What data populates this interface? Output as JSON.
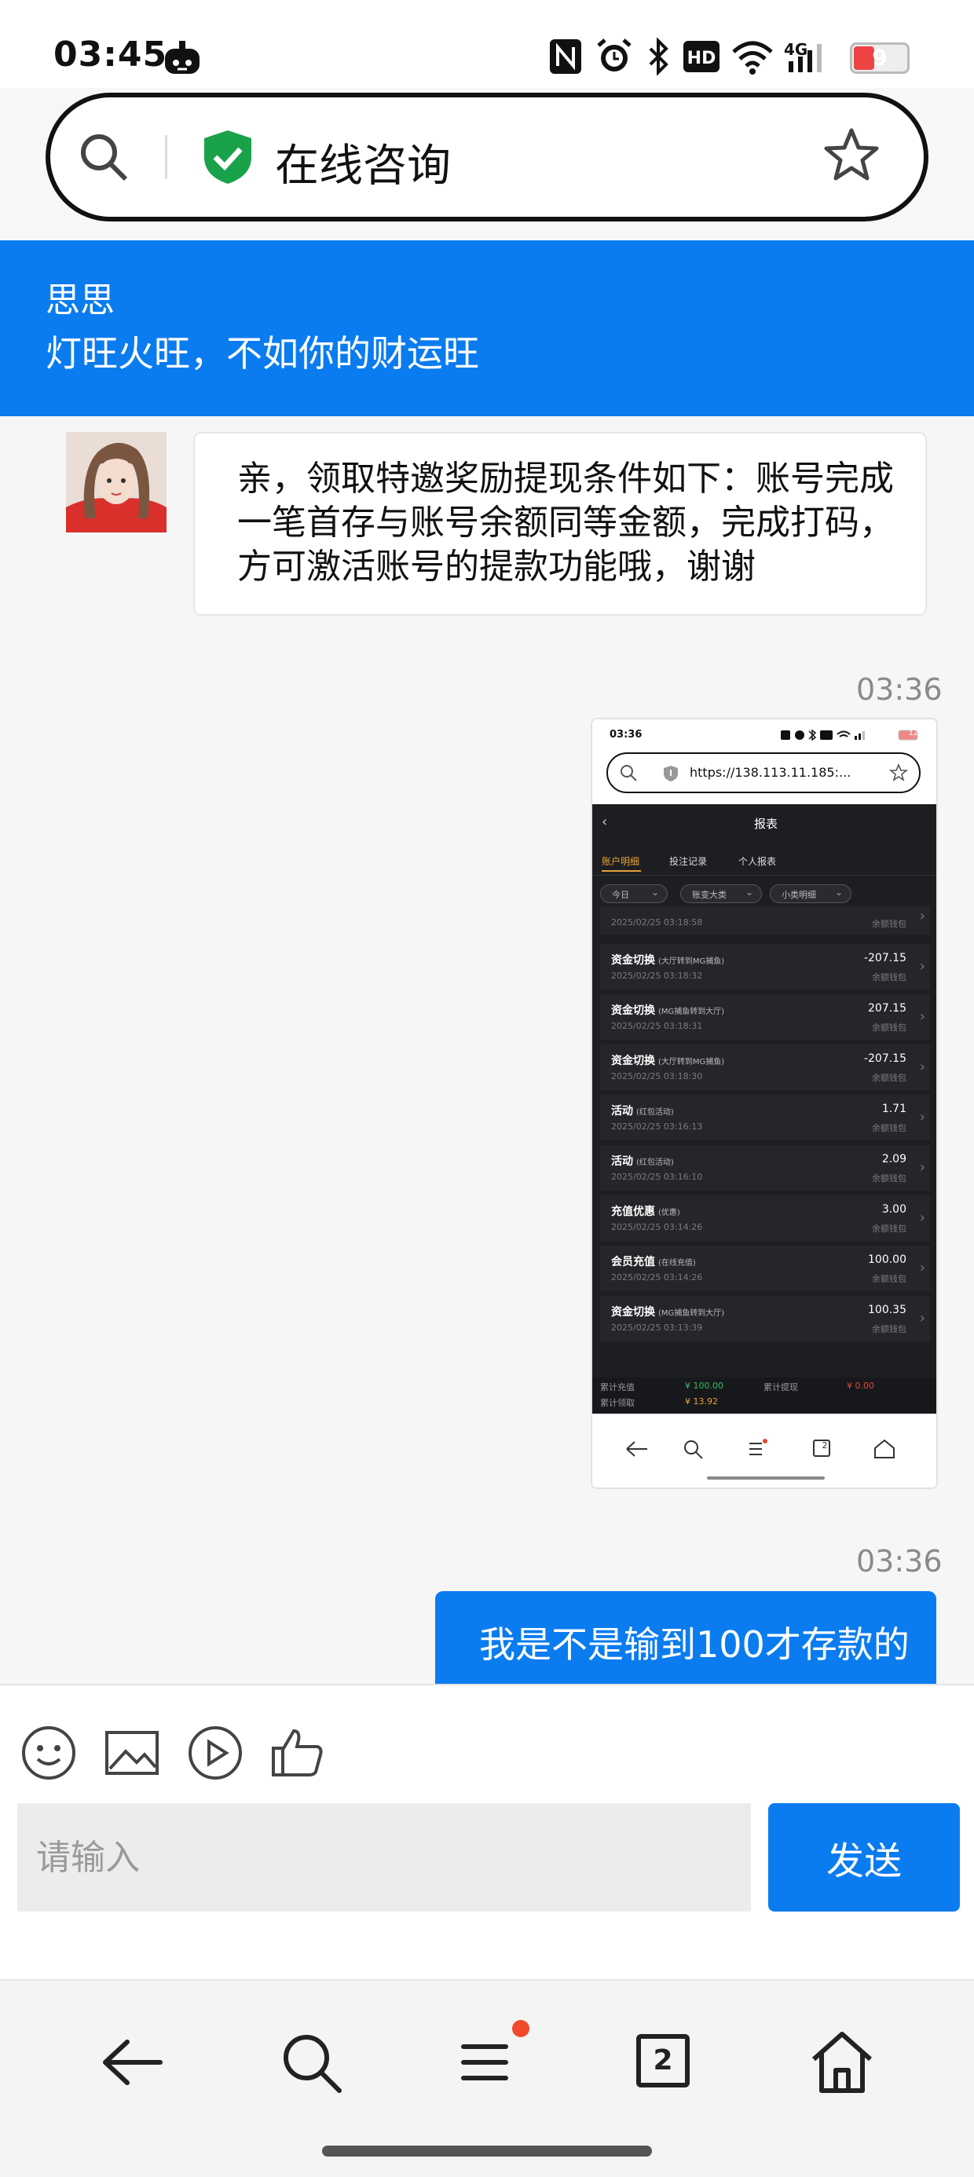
{
  "status_bar": {
    "time": "03:45",
    "battery": "9",
    "icons": [
      "robot-icon",
      "nfc-icon",
      "alarm-icon",
      "bluetooth-icon",
      "hd-icon",
      "wifi-icon",
      "4g-signal-icon",
      "battery-icon"
    ]
  },
  "browser": {
    "url_title": "在线咨询",
    "icons": [
      "search-icon",
      "shield-check-icon",
      "star-icon"
    ]
  },
  "chat": {
    "agent_name": "思思",
    "agent_motto": "灯旺火旺，不如你的财运旺",
    "messages": {
      "incoming_text": "亲，领取特邀奖励提现条件如下：账号完成一笔首存与账号余额同等金额，完成打码，方可激活账号的提款功能哦，谢谢",
      "ts1": "03:36",
      "ts2": "03:36",
      "outgoing_text": "我是不是输到100才存款的"
    }
  },
  "shared_screenshot": {
    "time": "03:36",
    "battery": "12",
    "url": "https://138.113.11.185:...",
    "page_title": "报表",
    "tabs": [
      "账户明细",
      "投注记录",
      "个人报表"
    ],
    "filters": [
      "今日",
      "账变大类",
      "小类明细"
    ],
    "partial_row": {
      "date": "2025/02/25 03:18:58",
      "sub": "余额钱包"
    },
    "rows": [
      {
        "title": "资金切换",
        "note": "(大厅转到MG捕鱼)",
        "date": "2025/02/25 03:18:32",
        "amount": "-207.15",
        "sub": "余额钱包"
      },
      {
        "title": "资金切换",
        "note": "(MG捕鱼转到大厅)",
        "date": "2025/02/25 03:18:31",
        "amount": "207.15",
        "sub": "余额钱包"
      },
      {
        "title": "资金切换",
        "note": "(大厅转到MG捕鱼)",
        "date": "2025/02/25 03:18:30",
        "amount": "-207.15",
        "sub": "余额钱包"
      },
      {
        "title": "活动",
        "note": "(红包活动)",
        "date": "2025/02/25 03:16:13",
        "amount": "1.71",
        "sub": "余额钱包"
      },
      {
        "title": "活动",
        "note": "(红包活动)",
        "date": "2025/02/25 03:16:10",
        "amount": "2.09",
        "sub": "余额钱包"
      },
      {
        "title": "充值优惠",
        "note": "(优惠)",
        "date": "2025/02/25 03:14:26",
        "amount": "3.00",
        "sub": "余额钱包"
      },
      {
        "title": "会员充值",
        "note": "(在线充值)",
        "date": "2025/02/25 03:14:26",
        "amount": "100.00",
        "sub": "余额钱包"
      },
      {
        "title": "资金切换",
        "note": "(MG捕鱼转到大厅)",
        "date": "2025/02/25 03:13:39",
        "amount": "100.35",
        "sub": "余额钱包"
      }
    ],
    "summary": {
      "deposit_label": "累计充值",
      "deposit_value": "¥ 100.00",
      "withdraw_label": "累计提现",
      "withdraw_value": "¥ 0.00",
      "claim_label": "累计领取",
      "claim_value": "¥ 13.92"
    },
    "nav_tab_count": "2"
  },
  "input": {
    "placeholder": "请输入",
    "send_label": "发送",
    "tools": [
      "emoji-icon",
      "image-icon",
      "video-icon",
      "thumbs-up-icon"
    ]
  },
  "bottom_nav": {
    "tab_count": "2",
    "icons": [
      "back-arrow-icon",
      "search-icon",
      "menu-icon",
      "tabs-icon",
      "home-icon"
    ],
    "badge_color": "#f04a2a"
  },
  "colors": {
    "accent": "#0a7cf0",
    "shield": "#1aa24a"
  }
}
